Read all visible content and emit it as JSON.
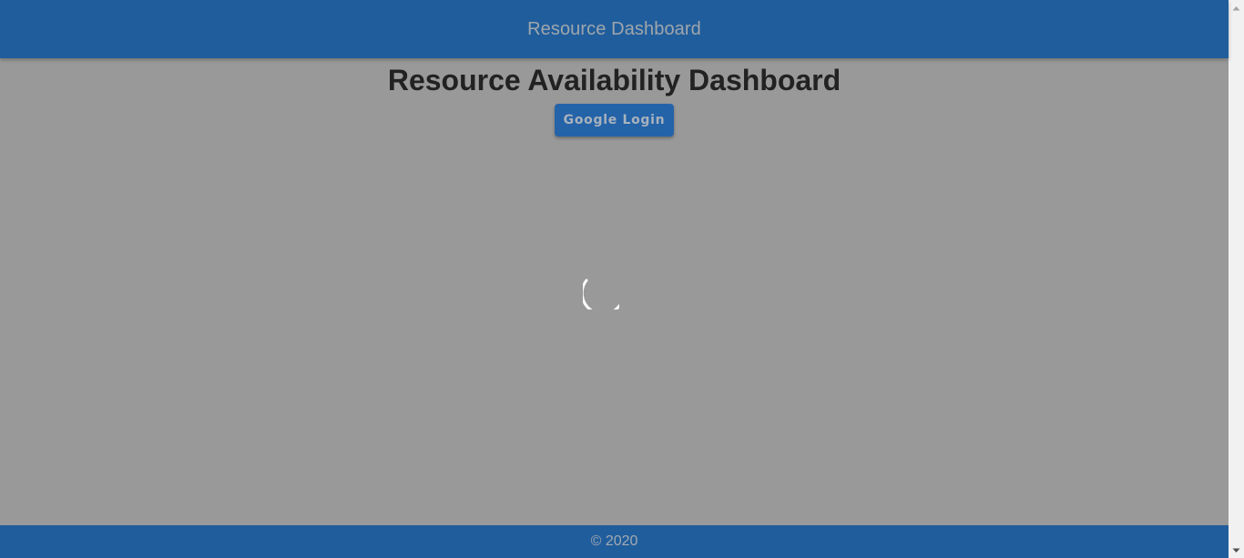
{
  "appbar": {
    "title": "Resource Dashboard"
  },
  "main": {
    "title": "Resource Availability Dashboard",
    "login_button": "Google Login"
  },
  "footer": {
    "copyright": "© 2020"
  },
  "colors": {
    "primary": "#205d9c",
    "overlay_background": "#999999",
    "spinner": "#ffffff"
  },
  "icons": {
    "spinner": "loading-spinner-icon",
    "scroll_up": "scroll-up-arrow-icon",
    "scroll_down": "scroll-down-arrow-icon"
  }
}
